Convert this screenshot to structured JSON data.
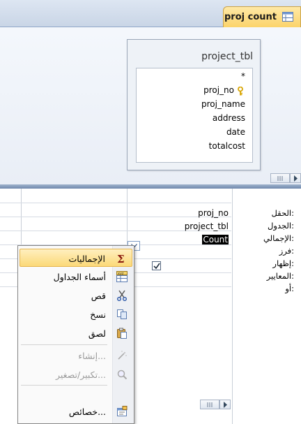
{
  "tab": {
    "title": "proj count",
    "icon": "query-icon"
  },
  "table": {
    "name": "project_tbl",
    "fields": [
      "*",
      "proj_no",
      "proj_name",
      "address",
      "date",
      "totalcost"
    ],
    "key_field": "proj_no"
  },
  "grid": {
    "row_labels": [
      "الحقل:",
      "الجدول:",
      "الإجمالي:",
      "فرز:",
      "إظهار:",
      "المعايير:",
      "أو:"
    ],
    "column": {
      "field": "proj_no",
      "table": "project_tbl",
      "total": "Count",
      "show": true
    }
  },
  "menu": {
    "items": [
      {
        "label": "الإجماليات",
        "icon": "sigma-icon",
        "highlighted": true,
        "disabled": false
      },
      {
        "label": "أسماء الجداول",
        "icon": "table-names-icon",
        "highlighted": false,
        "disabled": false
      },
      {
        "label": "قص",
        "icon": "scissors-icon",
        "highlighted": false,
        "disabled": false
      },
      {
        "label": "نسخ",
        "icon": "copy-icon",
        "highlighted": false,
        "disabled": false
      },
      {
        "label": "لصق",
        "icon": "paste-icon",
        "highlighted": false,
        "disabled": false
      },
      {
        "label": "إنشاء...",
        "icon": "build-icon",
        "highlighted": false,
        "disabled": true
      },
      {
        "label": "تكبير/تصغير...",
        "icon": "zoom-icon",
        "highlighted": false,
        "disabled": true
      },
      {
        "label": "خصائص...",
        "icon": "properties-icon",
        "highlighted": false,
        "disabled": false
      }
    ]
  },
  "colors": {
    "highlight": "#fbd978",
    "tab": "#fbd36a",
    "splitter": "#6f88ad"
  }
}
